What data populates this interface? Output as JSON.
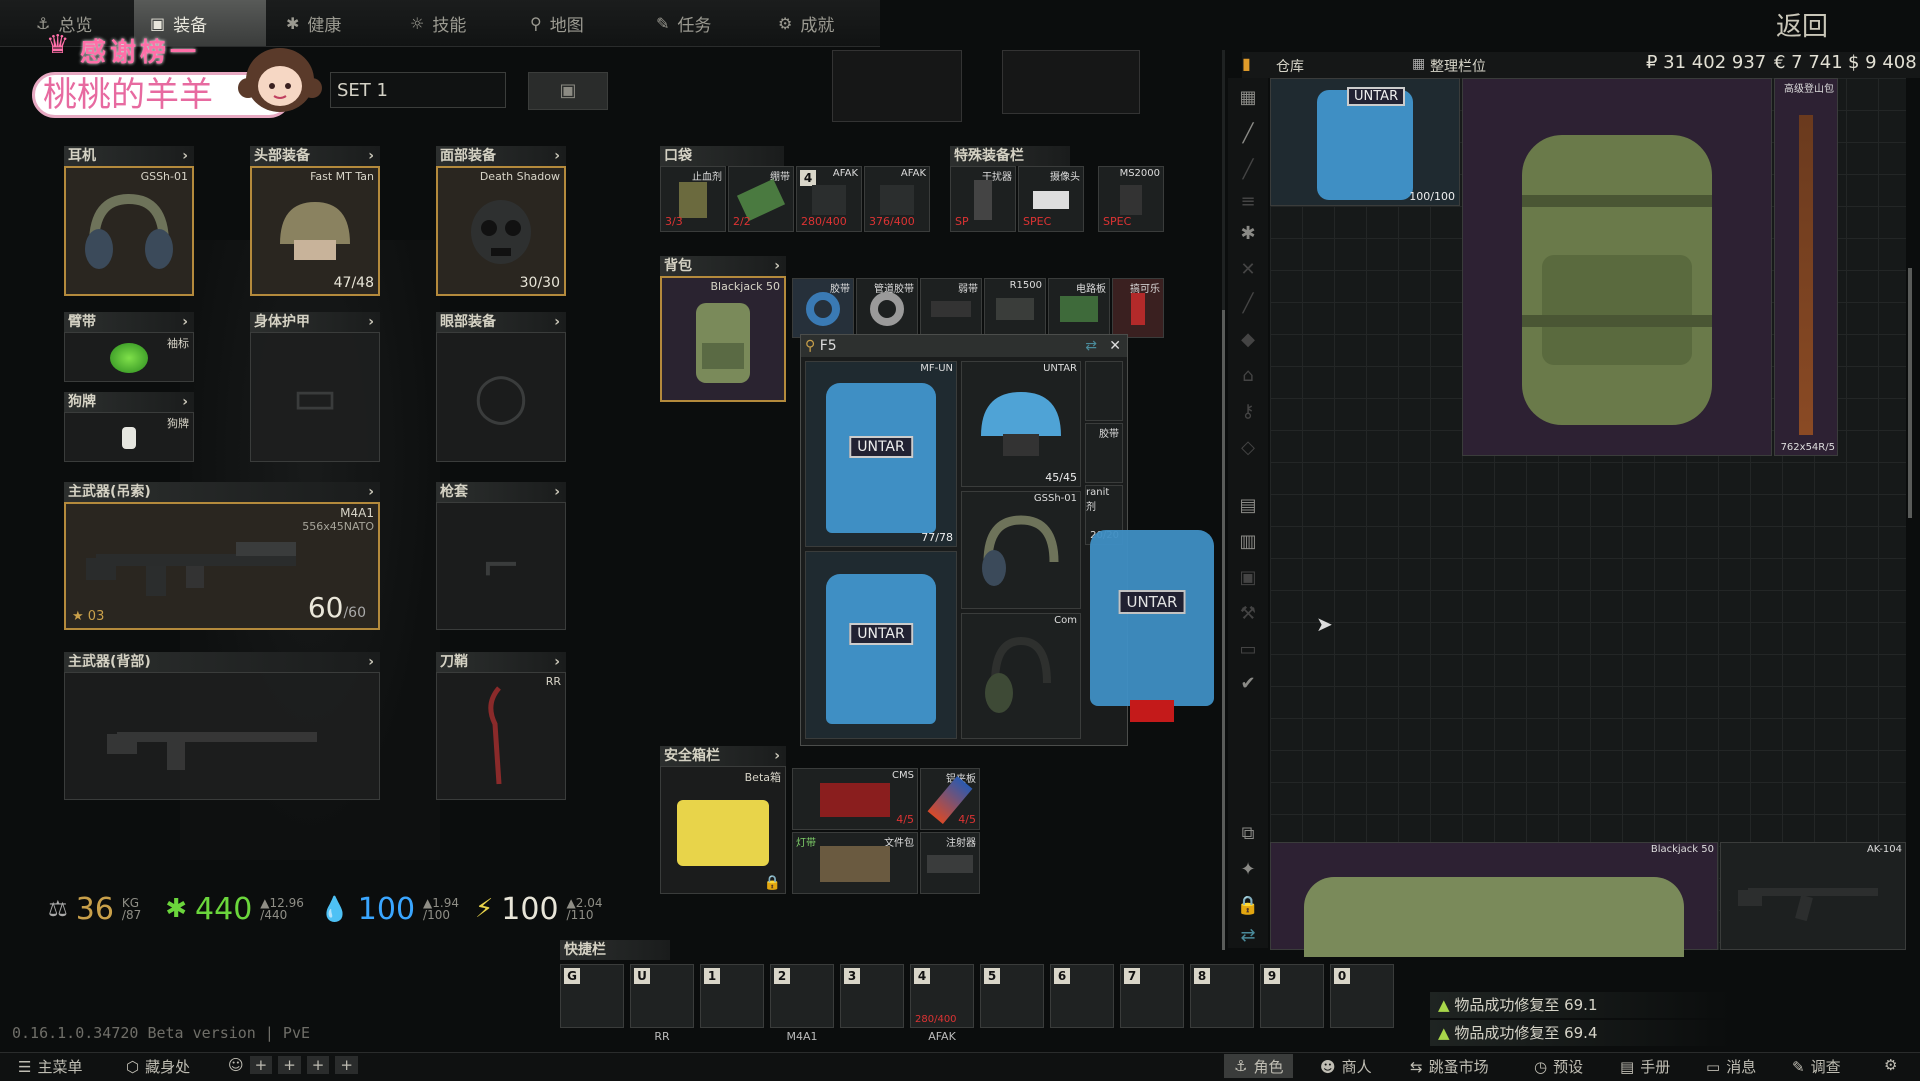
{
  "nav": {
    "tabs": [
      {
        "label": "总览",
        "icon": "person-icon"
      },
      {
        "label": "装备",
        "icon": "vest-icon"
      },
      {
        "label": "健康",
        "icon": "health-icon"
      },
      {
        "label": "技能",
        "icon": "skills-icon"
      },
      {
        "label": "地图",
        "icon": "map-pin-icon"
      },
      {
        "label": "任务",
        "icon": "task-icon"
      },
      {
        "label": "成就",
        "icon": "achievement-icon"
      }
    ],
    "back": "返回"
  },
  "overlay": {
    "thanks": "感谢榜一",
    "name": "桃桃的羊羊"
  },
  "preset": {
    "name": "SET 1"
  },
  "gear": {
    "earpiece": {
      "header": "耳机",
      "name": "GSSh-01"
    },
    "headwear": {
      "header": "头部装备",
      "name": "Fast MT Tan",
      "durability": "47/48"
    },
    "face": {
      "header": "面部装备",
      "name": "Death Shadow",
      "durability": "30/30"
    },
    "armband": {
      "header": "臂带",
      "name": "袖标"
    },
    "body_armor": {
      "header": "身体护甲"
    },
    "eyewear": {
      "header": "眼部装备"
    },
    "dogtag": {
      "header": "狗牌",
      "name": "狗牌"
    },
    "primary_sling": {
      "header": "主武器(吊索)",
      "name": "M4A1",
      "ammo_type": "556x45NATO",
      "ammo": "60",
      "ammo_max": "/60",
      "level": "03"
    },
    "holster": {
      "header": "枪套"
    },
    "primary_back": {
      "header": "主武器(背部)"
    },
    "scabbard": {
      "header": "刀鞘",
      "name": "RR"
    }
  },
  "pockets": {
    "header": "口袋",
    "items": [
      {
        "tag": "止血剂",
        "count": "3/3"
      },
      {
        "tag": "绷带",
        "count": "2/2"
      },
      {
        "tag": "AFAK",
        "count": "280/400",
        "key": "4"
      },
      {
        "tag": "AFAK",
        "count": "376/400"
      }
    ]
  },
  "special": {
    "header": "特殊装备栏",
    "items": [
      {
        "tag": "干扰器",
        "count": "SP"
      },
      {
        "tag": "摄像头",
        "count": "SPEC"
      },
      {
        "tag": "MS2000",
        "count": "SPEC"
      }
    ]
  },
  "backpack": {
    "header": "背包",
    "name": "Blackjack 50",
    "items": [
      {
        "tag": "胶带"
      },
      {
        "tag": "管道胶带"
      },
      {
        "tag": "弱带"
      },
      {
        "tag": "R1500"
      },
      {
        "tag": "电路板"
      },
      {
        "tag": "搞可乐"
      }
    ]
  },
  "popup": {
    "title": "F5",
    "items": [
      {
        "tag": "MF-UN",
        "label": "UNTAR",
        "dur": "77/78"
      },
      {
        "tag": "UNTAR",
        "dur": "45/45"
      },
      {
        "tag": "GSSh-01"
      },
      {
        "label": "UNTAR"
      },
      {
        "tag": "Com"
      }
    ],
    "side": [
      {
        "tag": "胶带"
      },
      {
        "tag": "ranit剂"
      },
      {
        "tag": "20/20"
      }
    ]
  },
  "dragged": {
    "label": "UNTAR"
  },
  "secure": {
    "header": "安全箱栏",
    "name": "Beta箱",
    "items": [
      {
        "tag": "CMS",
        "count": "4/5"
      },
      {
        "tag": "铝夹板",
        "count": "4/5"
      },
      {
        "tag": "文件包",
        "sub": "灯带"
      },
      {
        "tag": "注射器"
      }
    ]
  },
  "stats": {
    "weight": "36",
    "weight_unit": "KG",
    "weight_max": "/87",
    "hydration": "440",
    "hydration_max": "/440",
    "hydration_rate": "▲12.96",
    "water": "100",
    "water_max": "/100",
    "water_rate": "▲1.94",
    "energy": "100",
    "energy_max": "/110",
    "energy_rate": "▲2.04"
  },
  "quickbar": {
    "header": "快捷栏",
    "slots": [
      {
        "key": "G",
        "label": ""
      },
      {
        "key": "U",
        "label": "RR"
      },
      {
        "key": "1",
        "label": ""
      },
      {
        "key": "2",
        "label": "M4A1"
      },
      {
        "key": "3",
        "label": ""
      },
      {
        "key": "4",
        "label": "AFAK",
        "sub": "280/400"
      },
      {
        "key": "5",
        "label": ""
      },
      {
        "key": "6",
        "label": ""
      },
      {
        "key": "7",
        "label": ""
      },
      {
        "key": "8",
        "label": ""
      },
      {
        "key": "9",
        "label": ""
      },
      {
        "key": "0",
        "label": ""
      }
    ]
  },
  "version": "0.16.1.0.34720 Beta version | PvE",
  "stash": {
    "title": "仓库",
    "sort": "整理栏位",
    "currency_rub": "₽ 31 402 937",
    "currency_eur": "€ 7 741",
    "currency_usd": "$ 9 408",
    "items": [
      {
        "tag": "UNTAR",
        "dur": "100/100"
      },
      {
        "tag": "高级登山包"
      },
      {
        "tag": "762x54R",
        "count": "5"
      },
      {
        "tag": "Blackjack 50"
      },
      {
        "tag": "AK-104"
      }
    ]
  },
  "notifications": [
    {
      "text": "物品成功修复至 69.1"
    },
    {
      "text": "物品成功修复至 69.4"
    }
  ],
  "bottom": {
    "menu": "主菜单",
    "hideout": "藏身处",
    "character": "角色",
    "traders": "商人",
    "flea": "跳蚤市场",
    "presets": "预设",
    "handbook": "手册",
    "messages": "消息",
    "survey": "调查"
  },
  "colors": {
    "accent": "#b48a3c",
    "untar_blue": "#3f8fc4",
    "health_green": "#6bd63c",
    "water_blue": "#3aa6ff",
    "energy_yellow": "#e8d34a"
  }
}
